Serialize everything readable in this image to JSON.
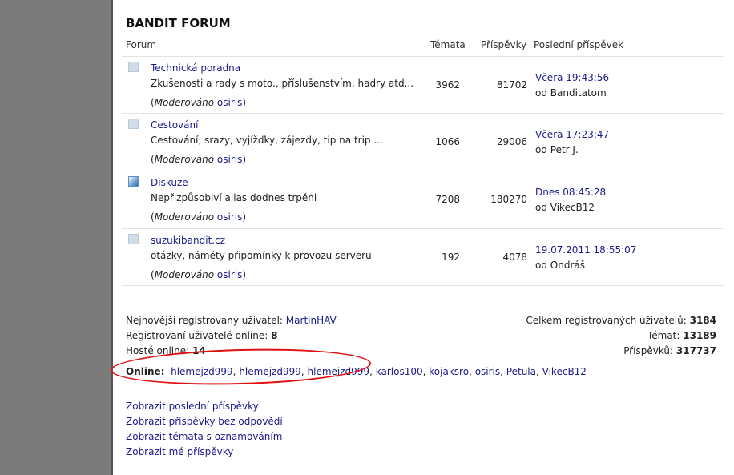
{
  "forum": {
    "title": "BANDIT FORUM",
    "headers": {
      "forum": "Forum",
      "topics": "Témata",
      "posts": "Příspěvky",
      "last_post": "Poslední příspěvek"
    },
    "rows": [
      {
        "name": "Technická poradna",
        "desc": "Zkušenosti a rady s moto., příslušenstvím, hadry atd...",
        "mod_prefix": "(",
        "mod_label": "Moderováno",
        "moderator": "osiris",
        "mod_suffix": ")",
        "topics": "3962",
        "posts": "81702",
        "last_time": "Včera 19:43:56",
        "last_by": "od Banditatom",
        "icon": "forum-read-icon"
      },
      {
        "name": "Cestování",
        "desc": "Cestování, srazy, vyjížďky, zájezdy, tip na trip ...",
        "mod_prefix": "(",
        "mod_label": "Moderováno",
        "moderator": "osiris",
        "mod_suffix": ")",
        "topics": "1066",
        "posts": "29006",
        "last_time": "Včera 17:23:47",
        "last_by": "od Petr J.",
        "icon": "forum-read-icon"
      },
      {
        "name": "Diskuze",
        "desc": "Nepřizpůsobiví alias dodnes trpěni",
        "mod_prefix": "(",
        "mod_label": "Moderováno",
        "moderator": "osiris",
        "mod_suffix": ")",
        "topics": "7208",
        "posts": "180270",
        "last_time": "Dnes 08:45:28",
        "last_by": "od VikecB12",
        "icon": "forum-new-posts-icon"
      },
      {
        "name": "suzukibandit.cz",
        "desc": "otázky, náměty připomínky k provozu serveru",
        "mod_prefix": "(",
        "mod_label": "Moderováno",
        "moderator": "osiris",
        "mod_suffix": ")",
        "topics": "192",
        "posts": "4078",
        "last_time": "19.07.2011 18:55:07",
        "last_by": "od Ondráš",
        "icon": "forum-read-icon"
      }
    ]
  },
  "stats": {
    "newest_label": "Nejnovější registrovaný uživatel:",
    "newest_user": "MartinHAV",
    "reg_online_label": "Registrovaní uživatelé online:",
    "reg_online": "8",
    "guests_label": "Hosté online:",
    "guests": "14",
    "total_users_label": "Celkem registrovaných uživatelů:",
    "total_users": "3184",
    "topics_label": "Témat:",
    "topics": "13189",
    "posts_label": "Příspěvků:",
    "posts": "317737",
    "online_label": "Online:",
    "online_users": [
      "hlemejzd999",
      "hlemejzd999",
      "hlemejzd999",
      "karlos100",
      "kojaksro",
      "osiris",
      "Petula",
      "VikecB12"
    ],
    "online_separator": ","
  },
  "links": [
    "Zobrazit poslední příspěvky",
    "Zobrazit příspěvky bez odpovědí",
    "Zobrazit témata s oznamováním",
    "Zobrazit mé příspěvky"
  ],
  "colors": {
    "link": "#1a1a8c",
    "annotation": "#e01010",
    "background": "#7b7b7b"
  }
}
